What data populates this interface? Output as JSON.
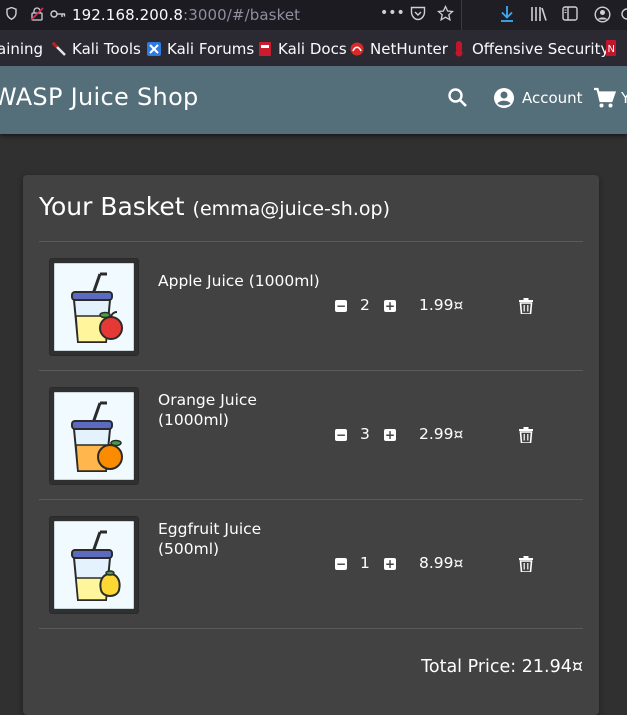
{
  "browser": {
    "url_host": "192.168.200.8",
    "url_rest": ":3000/#/basket",
    "url_actions_label": "•••",
    "bookmarks": [
      {
        "label": "aining",
        "color": "#2a2a2a"
      },
      {
        "label": "Kali Tools",
        "color": "#c21d1d"
      },
      {
        "label": "Kali Forums",
        "color": "#2e7be0"
      },
      {
        "label": "Kali Docs",
        "color": "#c91d2d"
      },
      {
        "label": "NetHunter",
        "color": "#d92a2a"
      },
      {
        "label": "Offensive Security",
        "color": "#c3152b"
      }
    ]
  },
  "app": {
    "title": "WASP Juice Shop",
    "account_label": "Account",
    "cart_label": "Y"
  },
  "basket": {
    "title": "Your Basket",
    "email": "(emma@juice-sh.op)",
    "items": [
      {
        "name_line1": "Apple Juice (1000ml)",
        "name_line2": "",
        "quantity": "2",
        "price": "1.99¤",
        "fruit": "apple",
        "fruit_color": "#e53935"
      },
      {
        "name_line1": "Orange Juice",
        "name_line2": "(1000ml)",
        "quantity": "3",
        "price": "2.99¤",
        "fruit": "orange",
        "fruit_color": "#fb8c00"
      },
      {
        "name_line1": "Eggfruit Juice",
        "name_line2": "(500ml)",
        "quantity": "1",
        "price": "8.99¤",
        "fruit": "eggfruit",
        "fruit_color": "#fdd835"
      }
    ],
    "total_label": "Total Price: 21.94¤"
  }
}
